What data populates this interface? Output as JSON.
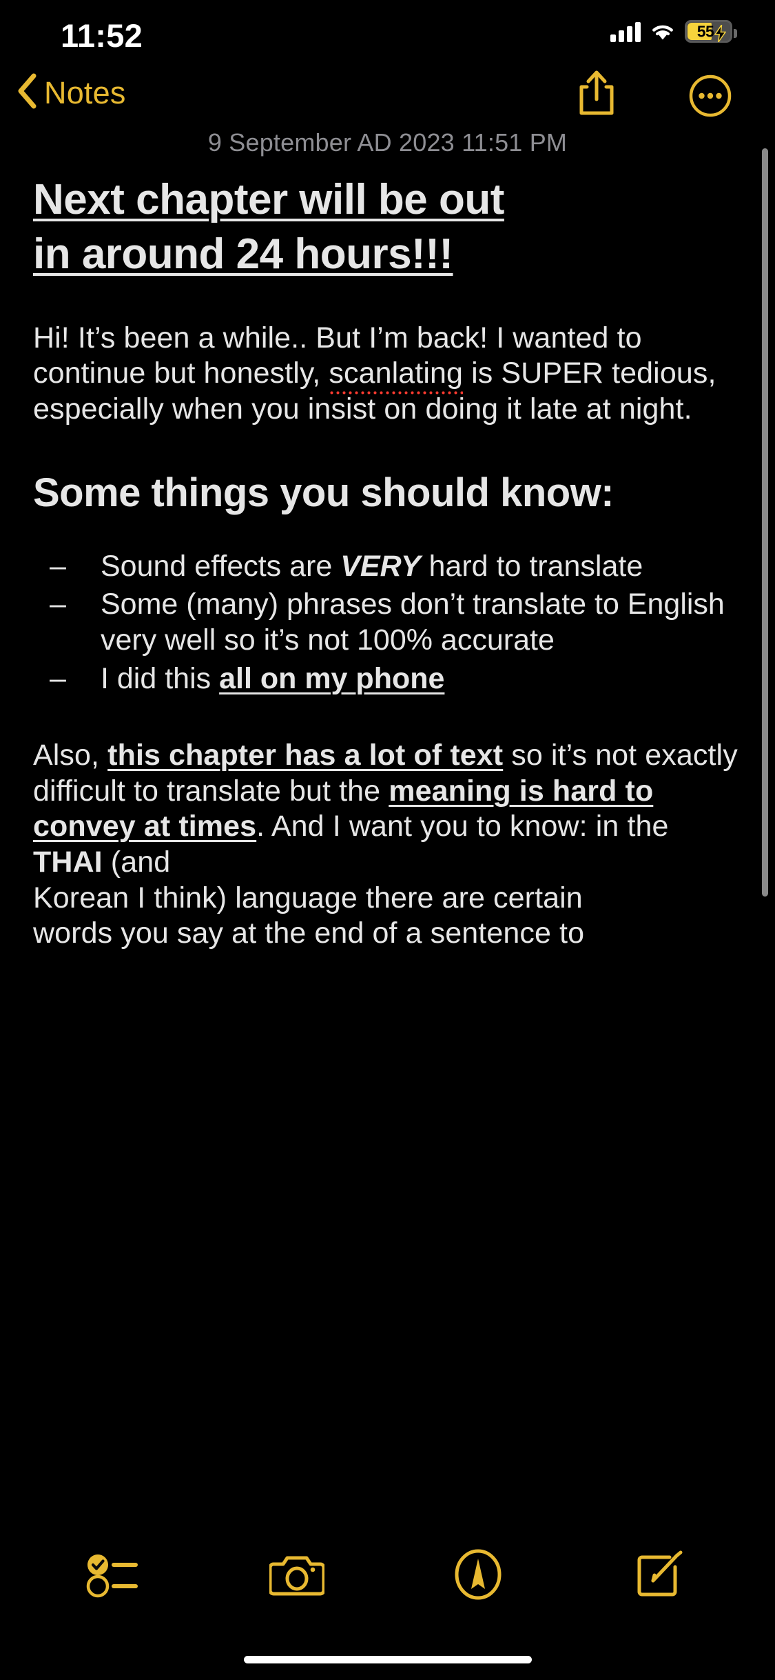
{
  "status_bar": {
    "time": "11:52",
    "signal_icon": "cellular-signal-icon",
    "wifi_icon": "wifi-icon",
    "battery_percent": "55",
    "battery_charging": true,
    "battery_color": "#F6D33C"
  },
  "nav_bar": {
    "back_label": "Notes",
    "back_icon": "chevron-left-icon",
    "share_icon": "share-icon",
    "more_icon": "more-ellipsis-icon",
    "accent_color": "#E8B931"
  },
  "note": {
    "date": "9 September AD 2023 11:51 PM",
    "title_line1": "Next chapter will be out",
    "title_line2": "in around 24 hours!!!",
    "intro_paragraph": {
      "before": "Hi! It’s been a while.. But I’m back! I wanted to continue but honestly, ",
      "misspelled_word": "scanlating",
      "after": " is SUPER tedious, especially when you insist on doing it late at night."
    },
    "heading_2": "Some things you should know:",
    "bullets": [
      {
        "marker": "–",
        "before": "Sound effects are ",
        "emphasis": "VERY",
        "after": " hard to translate"
      },
      {
        "marker": "–",
        "before": "Some (many) phrases don’t translate to English very well so it’s not 100% accurate",
        "emphasis": "",
        "after": ""
      },
      {
        "marker": "–",
        "before": "I did this ",
        "underlined": "all on my phone",
        "after": ""
      }
    ],
    "also_paragraph": {
      "p1": "Also, ",
      "u1": "this chapter has a lot of text",
      "p2": " so it’s not exactly difficult to translate but the ",
      "u2": "meaning is hard to convey at times",
      "p3": ". And I want you to know: in the ",
      "b1": "THAI",
      "p4": " (and"
    },
    "faded_line1": "Korean I think) language there are certain",
    "faded_line2": "words you say at the end of a sentence to"
  },
  "toolbar": {
    "checklist_icon": "checklist-icon",
    "camera_icon": "camera-icon",
    "markup_icon": "markup-pen-icon",
    "compose_icon": "compose-icon",
    "accent_color": "#E8B931"
  },
  "scrollbar": {
    "name": "vertical-scrollbar"
  },
  "home_indicator": {
    "name": "home-indicator"
  }
}
